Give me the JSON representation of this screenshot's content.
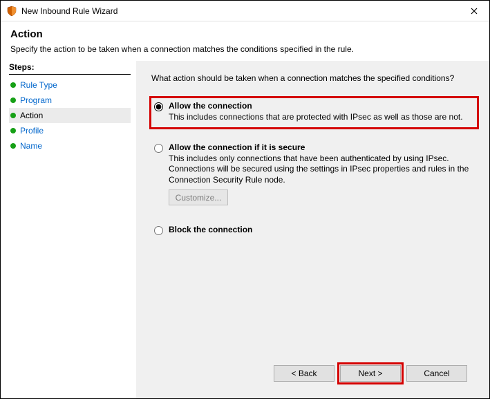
{
  "titlebar": {
    "title": "New Inbound Rule Wizard"
  },
  "header": {
    "title": "Action",
    "subtitle": "Specify the action to be taken when a connection matches the conditions specified in the rule."
  },
  "sidebar": {
    "title": "Steps:",
    "items": [
      {
        "label": "Rule Type",
        "current": false
      },
      {
        "label": "Program",
        "current": false
      },
      {
        "label": "Action",
        "current": true
      },
      {
        "label": "Profile",
        "current": false
      },
      {
        "label": "Name",
        "current": false
      }
    ]
  },
  "content": {
    "question": "What action should be taken when a connection matches the specified conditions?",
    "options": [
      {
        "id": "allow",
        "title": "Allow the connection",
        "desc": "This includes connections that are protected with IPsec as well as those are not.",
        "checked": true,
        "highlight": true
      },
      {
        "id": "allow_secure",
        "title": "Allow the connection if it is secure",
        "desc": "This includes only connections that have been authenticated by using IPsec. Connections will be secured using the settings in IPsec properties and rules in the Connection Security Rule node.",
        "checked": false,
        "customize_label": "Customize...",
        "customize_enabled": false
      },
      {
        "id": "block",
        "title": "Block the connection",
        "desc": "",
        "checked": false
      }
    ]
  },
  "footer": {
    "back": "< Back",
    "next": "Next >",
    "cancel": "Cancel"
  }
}
